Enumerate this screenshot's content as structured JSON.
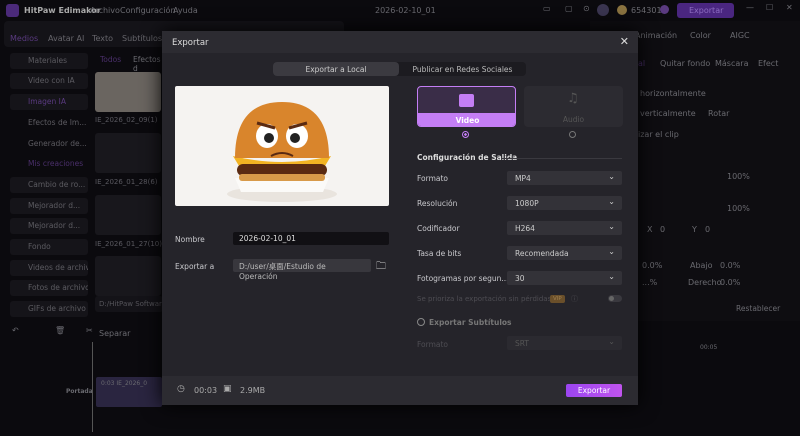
{
  "app": {
    "title": "HitPaw Edimakor",
    "menu": [
      "Archivo",
      "Configuración",
      "Ayuda"
    ],
    "project": "2026-02-10_01",
    "coins": "654301",
    "export_label": "Exportar"
  },
  "toolbar": [
    "Medios",
    "Avatar AI",
    "Texto",
    "Subtítulos"
  ],
  "sidebar": {
    "items": [
      "Materiales",
      "Video con IA",
      "Imagen IA",
      "Efectos de Im...",
      "Generador de...",
      "Mis creaciones",
      "Cambio de ro...",
      "Mejorador d...",
      "Mejorador d...",
      "Fondo",
      "Videos de archivo",
      "Fotos de archivo",
      "GIFs de archivo"
    ]
  },
  "media": {
    "tabs": [
      "Todos",
      "Efectos d"
    ],
    "items": [
      "IE_2026_02_09(1)",
      "IE_2026_01_28(6)",
      "IE_2026_01_27(10)"
    ],
    "path": "D:/HitPaw Softwar"
  },
  "right_panel": {
    "tabs": [
      "Animación",
      "Color",
      "AIGC"
    ],
    "subtabs": [
      "al",
      "Quitar fondo",
      "Máscara",
      "Efect"
    ],
    "buttons": [
      "horizontalmente",
      "verticalmente",
      "Rotar",
      "izar el clip"
    ],
    "scale": "100%",
    "opacity": "100%",
    "x_label": "X",
    "x": "0",
    "y_label": "Y",
    "y": "0",
    "crop": [
      "0.0%",
      "Abajo",
      "0.0%",
      "...%",
      "Derecho",
      "0.0%"
    ],
    "reset": "Restablecer"
  },
  "timeline": {
    "split": "Separar",
    "cover": "Portada",
    "clip": "0:03  IE_2026_0",
    "time": "00:05"
  },
  "modal": {
    "title": "Exportar",
    "tabs": [
      "Exportar a Local",
      "Publicar en Redes Sociales"
    ],
    "active_tab": 0,
    "name_label": "Nombre",
    "name_value": "2026-02-10_01",
    "export_to_label": "Exportar a",
    "export_to_value": "D:/user/桌面/Estudio de Operación",
    "types": [
      {
        "label": "Video",
        "selected": true
      },
      {
        "label": "Audio",
        "selected": false
      }
    ],
    "section_title": "Configuración de Salida",
    "settings": [
      {
        "label": "Formato",
        "value": "MP4"
      },
      {
        "label": "Resolución",
        "value": "1080P"
      },
      {
        "label": "Codificador",
        "value": "H264"
      },
      {
        "label": "Tasa de bits",
        "value": "Recomendada"
      },
      {
        "label": "Fotogramas por segun...",
        "value": "30"
      }
    ],
    "lossless_label": "Se prioriza la exportación sin pérdidas",
    "vip": "VIP",
    "lossless_on": false,
    "subtitles_label": "Exportar Subtítulos",
    "subtitles_checked": false,
    "sub_format_label": "Formato",
    "sub_format_value": "SRT",
    "duration": "00:03",
    "size": "2.9MB",
    "export_button": "Exportar",
    "accent": "#a855f7"
  }
}
